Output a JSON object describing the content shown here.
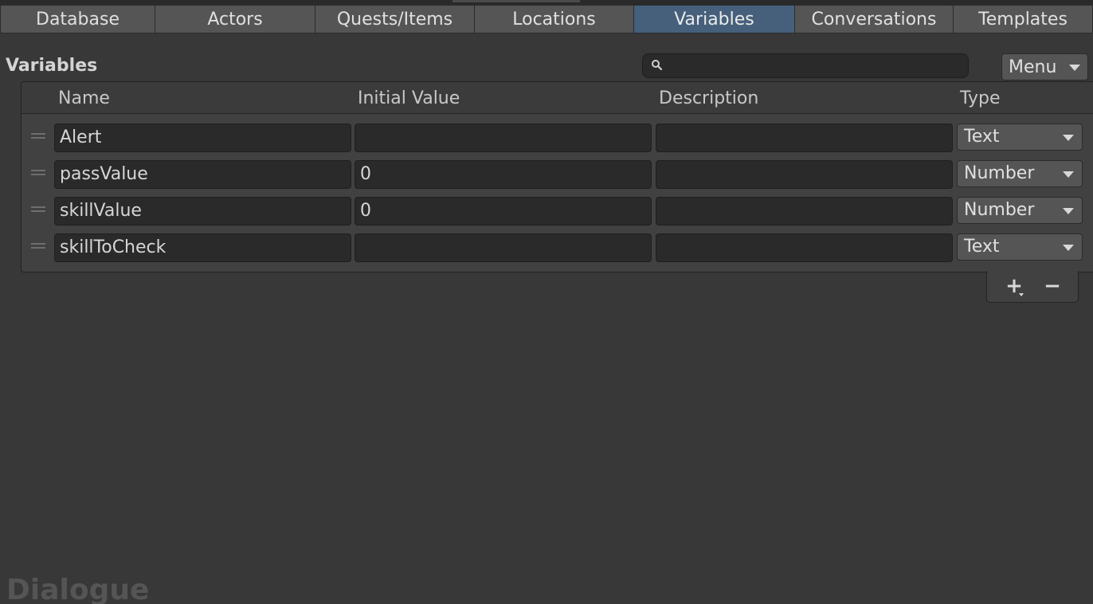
{
  "tabs": [
    {
      "label": "Database"
    },
    {
      "label": "Actors"
    },
    {
      "label": "Quests/Items"
    },
    {
      "label": "Locations"
    },
    {
      "label": "Variables"
    },
    {
      "label": "Conversations"
    },
    {
      "label": "Templates"
    }
  ],
  "active_tab": "Variables",
  "section": {
    "title": "Variables",
    "search": {
      "value": "",
      "placeholder": ""
    },
    "menu_label": "Menu"
  },
  "table": {
    "columns": [
      "Name",
      "Initial Value",
      "Description",
      "Type"
    ],
    "rows": [
      {
        "name": "Alert",
        "initial_value": "",
        "description": "",
        "type": "Text"
      },
      {
        "name": "passValue",
        "initial_value": "0",
        "description": "",
        "type": "Number"
      },
      {
        "name": "skillValue",
        "initial_value": "0",
        "description": "",
        "type": "Number"
      },
      {
        "name": "skillToCheck",
        "initial_value": "",
        "description": "",
        "type": "Text"
      }
    ]
  },
  "footer": {
    "add_label": "+",
    "remove_label": "−"
  },
  "watermark": "Dialogue",
  "colors": {
    "background": "#383838",
    "active_tab": "#46607c",
    "tab": "#555555",
    "field": "#2a2a2a"
  }
}
